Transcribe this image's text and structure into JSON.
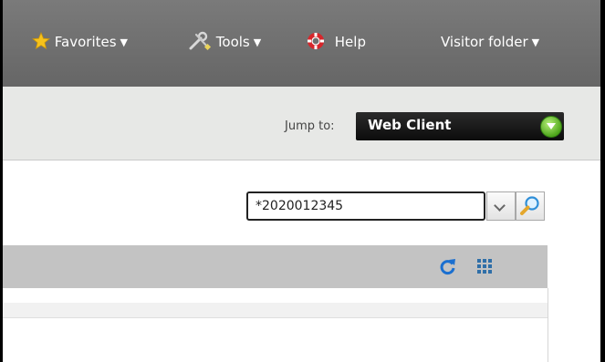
{
  "nav": {
    "favorites_label": "Favorites",
    "tools_label": "Tools",
    "help_label": "Help",
    "visitor_label": "Visitor folder"
  },
  "jump": {
    "label": "Jump to:",
    "value": "Web Client"
  },
  "search": {
    "value": "*2020012345"
  },
  "colors": {
    "topbar": "#6e6e6e",
    "jumpbar": "#e7e8e6",
    "panel_header": "#c3c3c3",
    "accent_blue": "#1a6fd0",
    "go_green": "#4fa61c"
  },
  "icons": {
    "favorites": "star-icon",
    "tools": "wrench-screwdriver-icon",
    "help": "lifebuoy-icon",
    "jump_go": "green-down-arrow-icon",
    "search": "magnifier-icon",
    "refresh": "refresh-icon",
    "grid": "grid-icon"
  }
}
